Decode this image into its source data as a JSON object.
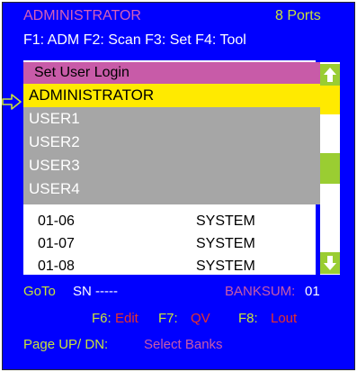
{
  "header": {
    "title": "ADMINISTRATOR",
    "ports": "8 Ports",
    "fkeys": "F1: ADM  F2: Scan  F3: Set  F4: Tool"
  },
  "popup": {
    "title": "Set User Login",
    "items": [
      "ADMINISTRATOR",
      "USER1",
      "USER2",
      "USER3",
      "USER4"
    ],
    "selected_index": 0
  },
  "rows": [
    {
      "id": "01-06",
      "name": "SYSTEM"
    },
    {
      "id": "01-07",
      "name": "SYSTEM"
    },
    {
      "id": "01-08",
      "name": "SYSTEM"
    }
  ],
  "footer": {
    "goto": "GoTo",
    "sn": "SN -----",
    "banksum_label": "BANKSUM:",
    "banksum_value": "01",
    "f6_key": "F6:",
    "f6_val": "Edit",
    "f7_key": "F7:",
    "f7_val": "QV",
    "f8_key": "F8:",
    "f8_val": "Lout",
    "pageupdn": "Page UP/ DN:",
    "select_banks": "Select Banks"
  },
  "colors": {
    "background": "#0000ff",
    "accent_green": "#c7e23a",
    "accent_magenta": "#c85ba8",
    "highlight_yellow": "#ffea00",
    "popup_gray": "#a6a6a6",
    "scroll_green": "#9acd32",
    "hotkey_red": "#e8312a"
  },
  "icons": {
    "pointer": "arrow-right-outline-icon",
    "scroll_up": "arrow-up-icon",
    "scroll_down": "arrow-down-icon"
  }
}
